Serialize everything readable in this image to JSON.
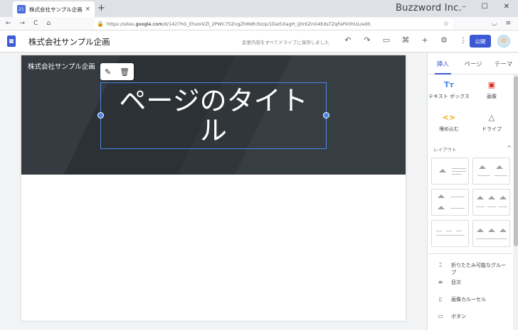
{
  "browser": {
    "tab_title": "株式会社サンプル企画",
    "favicon_label": "21",
    "tab_close": "×",
    "new_tab": "+",
    "brand": "Buzzword Inc.",
    "window_buttons": [
      "–",
      "☐",
      "✕"
    ],
    "nav": [
      "←",
      "→",
      "C",
      "⌂"
    ],
    "url_prefix": "https://sites.",
    "url_domain": "google.com",
    "url_rest": "/d/1427hG_EhxoiVZl_2PWC75ZngZhMdh3Iz/p/1DaI5XagH_iJ0rKZnG4EdsTZqFeFk0hUL/edit"
  },
  "sites": {
    "site_name": "株式会社サンプル企画",
    "save_status": "変更内容をすべてドライブに保存しました",
    "publish_label": "公開",
    "tools": [
      "↶",
      "↷",
      "▭",
      "⌘",
      "+",
      "⚙",
      "⋮"
    ]
  },
  "page": {
    "header_site_title": "株式会社サンプル企画",
    "title_text": "ページのタイトル",
    "edit_icon": "✎",
    "delete_icon": "🗑"
  },
  "panel": {
    "tabs": [
      "挿入",
      "ページ",
      "テーマ"
    ],
    "insert_items": [
      {
        "icon": "Tт",
        "label": "テキスト ボックス"
      },
      {
        "icon": "▣",
        "label": "画像"
      },
      {
        "icon": "<>",
        "label": "埋め込む"
      },
      {
        "icon": "△",
        "label": "ドライブ"
      }
    ],
    "layout_header": "レイアウト",
    "layout_chevron": "^",
    "components": [
      {
        "icon": "⌶",
        "label": "折りたたみ可能なグループ"
      },
      {
        "icon": "≡",
        "label": "目次"
      },
      {
        "icon": "▯",
        "label": "画像カルーセル"
      },
      {
        "icon": "▭",
        "label": "ボタン"
      }
    ]
  }
}
